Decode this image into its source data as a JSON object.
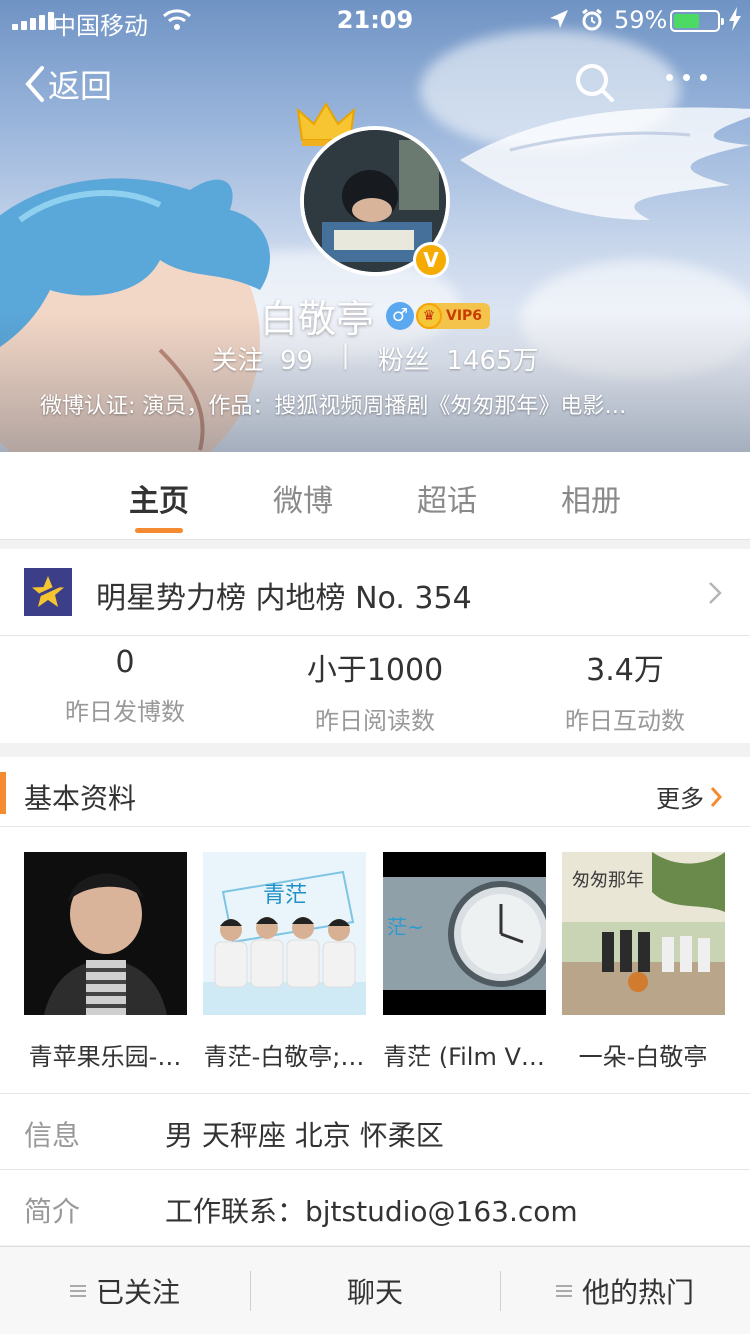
{
  "status_bar": {
    "carrier": "中国移动",
    "time": "21:09",
    "battery_percent": "59%",
    "battery_level": 0.59
  },
  "nav": {
    "back_label": "返回"
  },
  "profile": {
    "name": "白敬亭",
    "verified_mark": "V",
    "vip_label": "VIP6",
    "following_label": "关注",
    "following_count": "99",
    "followers_label": "粉丝",
    "followers_count": "1465万",
    "verification": "微博认证: 演员，作品：搜狐视频周播剧《匆匆那年》电影…"
  },
  "tabs": [
    {
      "label": "主页"
    },
    {
      "label": "微博"
    },
    {
      "label": "超话"
    },
    {
      "label": "相册"
    }
  ],
  "ranking": {
    "title": "明星势力榜  内地榜 No. 354",
    "stats": [
      {
        "value": "0",
        "label": "昨日发博数"
      },
      {
        "value": "小于1000",
        "label": "昨日阅读数"
      },
      {
        "value": "3.4万",
        "label": "昨日互动数"
      }
    ]
  },
  "basic_info": {
    "title": "基本资料",
    "more_label": "更多",
    "thumbnails": [
      {
        "caption": "青苹果乐园-…"
      },
      {
        "caption": "青茫-白敬亭;…"
      },
      {
        "caption": "青茫 (Film V…"
      },
      {
        "caption": "一朵-白敬亭"
      }
    ],
    "rows": [
      {
        "key": "信息",
        "value": "男  天秤座  北京 怀柔区"
      },
      {
        "key": "简介",
        "value": "工作联系：bjtstudio@163.com"
      }
    ]
  },
  "bottom_bar": {
    "follow_label": "已关注",
    "chat_label": "聊天",
    "hot_label": "他的热门"
  },
  "colors": {
    "accent": "#f58b30",
    "verified": "#f6ab00",
    "gender": "#5aa8f0",
    "battery": "#4cd964"
  }
}
